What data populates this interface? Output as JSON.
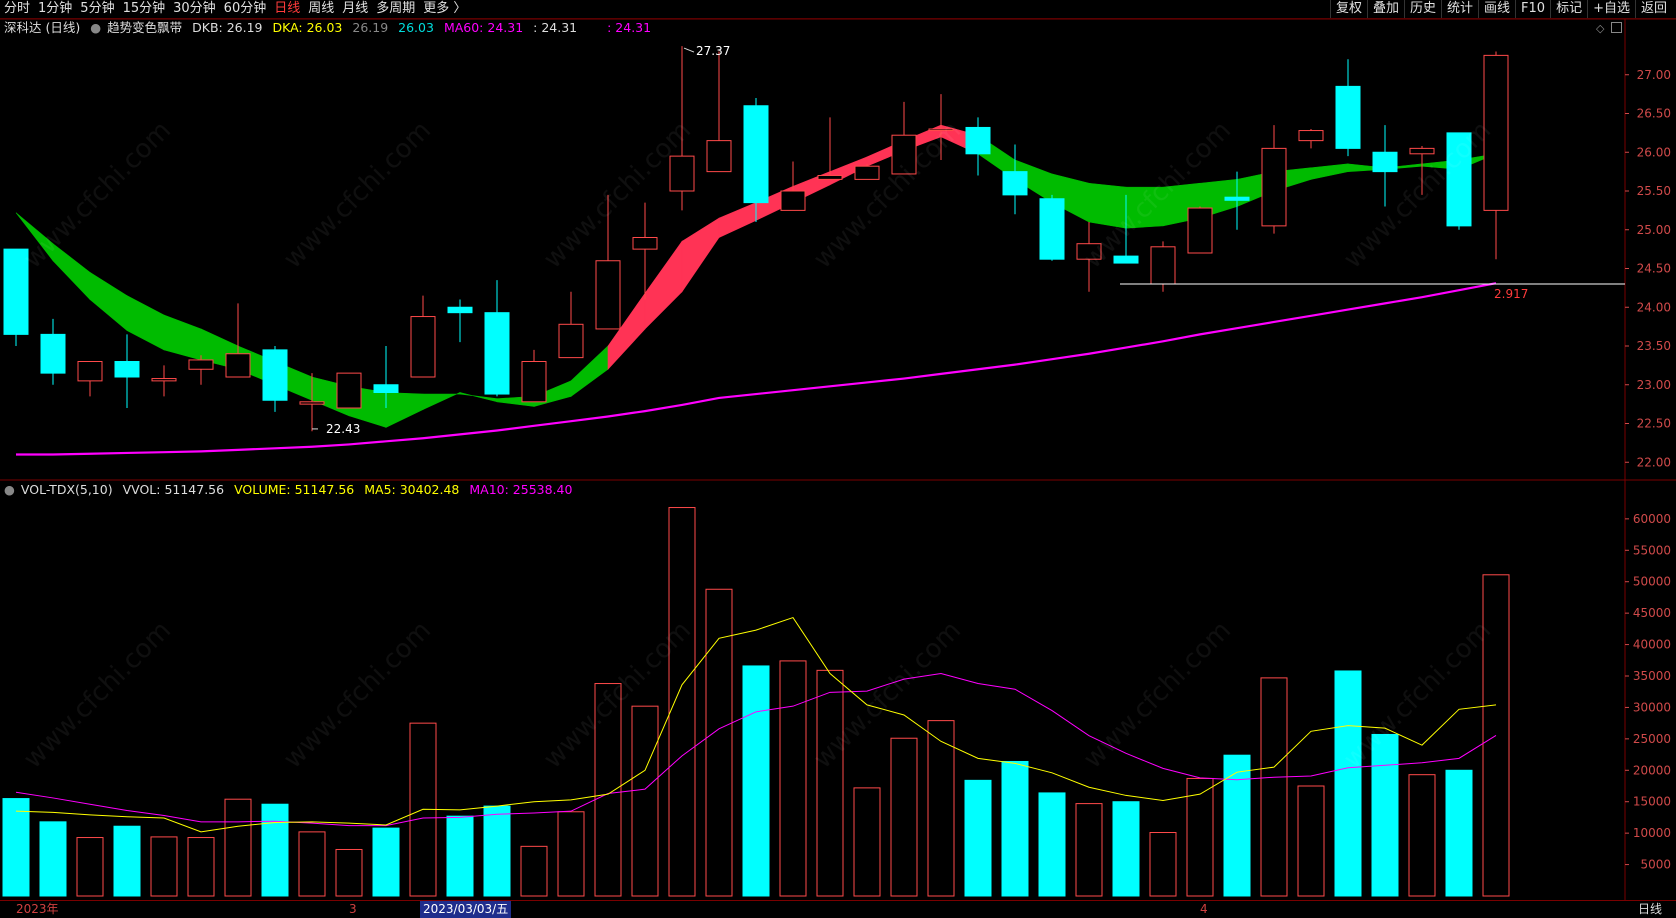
{
  "toolbar": {
    "tabs": [
      {
        "label": "分时",
        "active": false
      },
      {
        "label": "1分钟",
        "active": false
      },
      {
        "label": "5分钟",
        "active": false
      },
      {
        "label": "15分钟",
        "active": false
      },
      {
        "label": "30分钟",
        "active": false
      },
      {
        "label": "60分钟",
        "active": false
      },
      {
        "label": "日线",
        "active": true
      },
      {
        "label": "周线",
        "active": false
      },
      {
        "label": "月线",
        "active": false
      },
      {
        "label": "多周期",
        "active": false
      },
      {
        "label": "更多 〉",
        "active": false
      }
    ],
    "right_buttons": [
      "复权",
      "叠加",
      "历史",
      "统计",
      "画线",
      "F10",
      "标记",
      "+自选",
      "返回"
    ]
  },
  "price_legend": {
    "stock": "深科达 (日线)",
    "indicator": "趋势变色飘带",
    "dkb": "DKB: 26.19",
    "dka": "DKA: 26.03",
    "v1": "26.19",
    "v2": "26.03",
    "ma60": "MA60: 24.31",
    "v3": ": 24.31",
    "v4": ": 24.31"
  },
  "volume_legend": {
    "name": "VOL-TDX(5,10)",
    "vvol": "VVOL: 51147.56",
    "volume": "VOLUME: 51147.56",
    "ma5": "MA5: 30402.48",
    "ma10": "MA10: 25538.40"
  },
  "annotations": {
    "high": "27.37",
    "low": "22.43",
    "range": "2.917"
  },
  "bottom": {
    "year": "2023年",
    "m3": "3",
    "date": "2023/03/03/五",
    "m4": "4",
    "period": "日线"
  },
  "watermark": "www.cfchi.com",
  "colors": {
    "up": "#ff4a4a",
    "down": "#00ffff",
    "ma60": "#ff00ff",
    "ma5": "#ffff00",
    "ma10": "#ff00ff",
    "band_up": "#ff3355",
    "band_down": "#00bb00"
  },
  "chart_data": [
    {
      "type": "candlestick",
      "title": "深科达 (日线)",
      "ylim": [
        21.9,
        27.5
      ],
      "yticks": [
        22.0,
        22.5,
        23.0,
        23.5,
        24.0,
        24.5,
        25.0,
        25.5,
        26.0,
        26.5,
        27.0
      ],
      "candles": [
        {
          "o": 24.75,
          "h": 24.75,
          "l": 23.5,
          "c": 23.65
        },
        {
          "o": 23.65,
          "h": 23.85,
          "l": 23.0,
          "c": 23.15
        },
        {
          "o": 23.05,
          "h": 23.3,
          "l": 22.85,
          "c": 23.3
        },
        {
          "o": 23.3,
          "h": 23.65,
          "l": 22.7,
          "c": 23.1
        },
        {
          "o": 23.05,
          "h": 23.25,
          "l": 22.85,
          "c": 23.08
        },
        {
          "o": 23.2,
          "h": 23.38,
          "l": 23.0,
          "c": 23.32
        },
        {
          "o": 23.1,
          "h": 24.05,
          "l": 23.1,
          "c": 23.4
        },
        {
          "o": 23.45,
          "h": 23.5,
          "l": 22.65,
          "c": 22.8
        },
        {
          "o": 22.75,
          "h": 23.15,
          "l": 22.4,
          "c": 22.78
        },
        {
          "o": 22.7,
          "h": 23.15,
          "l": 22.7,
          "c": 23.15
        },
        {
          "o": 23.0,
          "h": 23.5,
          "l": 22.7,
          "c": 22.9
        },
        {
          "o": 23.1,
          "h": 24.15,
          "l": 23.1,
          "c": 23.88
        },
        {
          "o": 24.0,
          "h": 24.1,
          "l": 23.55,
          "c": 23.93
        },
        {
          "o": 23.93,
          "h": 24.35,
          "l": 22.85,
          "c": 22.88
        },
        {
          "o": 22.78,
          "h": 23.45,
          "l": 22.78,
          "c": 23.3
        },
        {
          "o": 23.35,
          "h": 24.2,
          "l": 23.35,
          "c": 23.78
        },
        {
          "o": 23.72,
          "h": 25.45,
          "l": 23.72,
          "c": 24.6
        },
        {
          "o": 24.75,
          "h": 25.35,
          "l": 24.1,
          "c": 24.9
        },
        {
          "o": 25.5,
          "h": 27.37,
          "l": 25.25,
          "c": 25.95
        },
        {
          "o": 25.75,
          "h": 27.3,
          "l": 25.75,
          "c": 26.15
        },
        {
          "o": 26.6,
          "h": 26.7,
          "l": 25.1,
          "c": 25.35
        },
        {
          "o": 25.25,
          "h": 25.88,
          "l": 25.25,
          "c": 25.5
        },
        {
          "o": 25.65,
          "h": 26.45,
          "l": 25.65,
          "c": 25.7
        },
        {
          "o": 25.65,
          "h": 25.85,
          "l": 25.65,
          "c": 25.82
        },
        {
          "o": 25.72,
          "h": 26.65,
          "l": 25.72,
          "c": 26.22
        },
        {
          "o": 26.3,
          "h": 26.75,
          "l": 25.9,
          "c": 26.3
        },
        {
          "o": 26.32,
          "h": 26.45,
          "l": 25.7,
          "c": 25.98
        },
        {
          "o": 25.75,
          "h": 26.1,
          "l": 25.2,
          "c": 25.45
        },
        {
          "o": 25.4,
          "h": 25.45,
          "l": 24.6,
          "c": 24.62
        },
        {
          "o": 24.62,
          "h": 25.1,
          "l": 24.2,
          "c": 24.82
        },
        {
          "o": 24.66,
          "h": 25.45,
          "l": 24.57,
          "c": 24.57
        },
        {
          "o": 24.3,
          "h": 24.85,
          "l": 24.2,
          "c": 24.78
        },
        {
          "o": 24.7,
          "h": 25.3,
          "l": 24.7,
          "c": 25.28
        },
        {
          "o": 25.42,
          "h": 25.75,
          "l": 25.0,
          "c": 25.38
        },
        {
          "o": 25.05,
          "h": 26.35,
          "l": 24.95,
          "c": 26.05
        },
        {
          "o": 26.15,
          "h": 26.3,
          "l": 26.05,
          "c": 26.28
        },
        {
          "o": 26.85,
          "h": 27.2,
          "l": 25.95,
          "c": 26.05
        },
        {
          "o": 26.0,
          "h": 26.35,
          "l": 25.3,
          "c": 25.75
        },
        {
          "o": 25.98,
          "h": 26.08,
          "l": 25.45,
          "c": 26.05
        },
        {
          "o": 26.25,
          "h": 26.25,
          "l": 25.0,
          "c": 25.05
        },
        {
          "o": 25.25,
          "h": 27.3,
          "l": 24.62,
          "c": 27.25
        }
      ],
      "ma60": [
        22.1,
        22.1,
        22.11,
        22.12,
        22.13,
        22.14,
        22.16,
        22.18,
        22.2,
        22.23,
        22.27,
        22.31,
        22.36,
        22.41,
        22.47,
        22.53,
        22.59,
        22.66,
        22.74,
        22.83,
        22.88,
        22.93,
        22.98,
        23.03,
        23.08,
        23.14,
        23.2,
        23.26,
        23.33,
        23.4,
        23.48,
        23.56,
        23.65,
        23.73,
        23.81,
        23.89,
        23.97,
        24.05,
        24.13,
        24.22,
        24.31
      ],
      "band_upper": [
        25.22,
        24.82,
        24.45,
        24.15,
        23.9,
        23.72,
        23.5,
        23.3,
        23.1,
        22.98,
        22.9,
        22.88,
        22.88,
        22.82,
        22.85,
        23.05,
        23.5,
        24.18,
        24.85,
        25.15,
        25.35,
        25.56,
        25.75,
        25.94,
        26.15,
        26.35,
        26.22,
        25.9,
        25.72,
        25.6,
        25.55,
        25.55,
        25.6,
        25.65,
        25.75,
        25.8,
        25.85,
        25.8,
        25.85,
        25.9,
        25.98
      ],
      "band_lower": [
        25.22,
        24.6,
        24.1,
        23.7,
        23.45,
        23.32,
        23.2,
        23.0,
        22.8,
        22.6,
        22.45,
        22.68,
        22.9,
        22.78,
        22.72,
        22.85,
        23.2,
        23.72,
        24.2,
        24.9,
        25.12,
        25.35,
        25.58,
        25.82,
        26.02,
        26.2,
        25.98,
        25.65,
        25.35,
        25.1,
        25.02,
        25.05,
        25.15,
        25.3,
        25.5,
        25.65,
        25.75,
        25.78,
        25.82,
        25.78,
        25.98
      ],
      "band_color": [
        "down",
        "down",
        "down",
        "down",
        "down",
        "down",
        "down",
        "down",
        "down",
        "down",
        "down",
        "down",
        "down",
        "down",
        "down",
        "down",
        "up",
        "up",
        "up",
        "up",
        "up",
        "up",
        "up",
        "up",
        "up",
        "up",
        "down",
        "down",
        "down",
        "down",
        "down",
        "down",
        "down",
        "down",
        "down",
        "down",
        "down",
        "down",
        "down",
        "down",
        "down"
      ]
    },
    {
      "type": "bar",
      "title": "VOL-TDX(5,10)",
      "ylim": [
        0,
        63000
      ],
      "yticks": [
        5000,
        10000,
        15000,
        20000,
        25000,
        30000,
        35000,
        40000,
        45000,
        50000,
        55000,
        60000
      ],
      "volume": [
        15500,
        11800,
        9300,
        11100,
        9400,
        9300,
        15400,
        14600,
        10200,
        7400,
        10800,
        27500,
        12700,
        14300,
        7900,
        13400,
        33800,
        30200,
        61800,
        48800,
        36600,
        37400,
        35900,
        17200,
        25100,
        27900,
        18400,
        21400,
        16400,
        14700,
        15000,
        10100,
        18700,
        22400,
        34700,
        17500,
        35800,
        25700,
        19300,
        20000,
        51100
      ],
      "ma5": [
        13500,
        13300,
        12900,
        12600,
        12400,
        10200,
        11100,
        11700,
        11800,
        11600,
        11300,
        13800,
        13700,
        14300,
        15000,
        15300,
        16200,
        20000,
        33600,
        41000,
        42300,
        44300,
        35400,
        30400,
        28800,
        24600,
        21900,
        21100,
        19600,
        17300,
        16000,
        15200,
        16200,
        19700,
        20500,
        26200,
        27100,
        26700,
        24000,
        29700,
        30402
      ],
      "ma10": [
        16500,
        15600,
        14600,
        13600,
        12800,
        11800,
        11800,
        11900,
        11600,
        11200,
        11200,
        12400,
        12500,
        13000,
        13200,
        13500,
        16300,
        17000,
        22300,
        26600,
        29300,
        30200,
        32400,
        32600,
        34500,
        35400,
        33800,
        32900,
        29500,
        25500,
        22700,
        20300,
        18800,
        18500,
        18900,
        19100,
        20400,
        20800,
        21200,
        21900,
        25538
      ]
    }
  ]
}
